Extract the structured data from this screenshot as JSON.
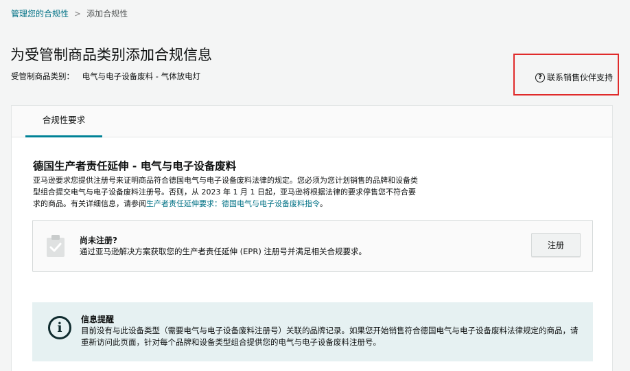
{
  "breadcrumb": {
    "parent": "管理您的合规性",
    "separator": ">",
    "current": "添加合规性"
  },
  "page": {
    "title": "为受管制商品类别添加合规信息",
    "category_label": "受管制商品类别：",
    "category_value": "电气与电子设备废料 - 气体放电灯"
  },
  "support": {
    "icon": "help-circle-icon",
    "icon_glyph": "?",
    "label": "联系销售伙伴支持",
    "highlight_color": "#e02a2a"
  },
  "tabs": [
    {
      "label": "合规性要求",
      "active": true
    }
  ],
  "section": {
    "title": "德国生产者责任延伸 - 电气与电子设备废料",
    "desc_line1": "亚马逊要求您提供注册号来证明商品符合德国电气与电子设备废料法律的规定。您必须为您计划销售的品牌和设备类",
    "desc_line2": "型组合提交电气与电子设备废料注册号。否则，从 2023 年 1 月 1 日起，亚马逊将根据法律的要求停售您不符合要",
    "desc_line3_prefix": "求的商品。有关详细信息，请参阅",
    "desc_link": "生产者责任延伸要求：德国电气与电子设备废料指令",
    "desc_line3_suffix": "。"
  },
  "registration": {
    "icon": "clipboard-check-icon",
    "title": "尚未注册?",
    "description": "通过亚马逊解决方案获取您的生产者责任延伸 (EPR) 注册号并满足相关合规要求。",
    "button_label": "注册"
  },
  "info": {
    "icon": "info-icon",
    "icon_glyph": "i",
    "title": "信息提醒",
    "text": "目前没有与此设备类型（需要电气与电子设备废料注册号）关联的品牌记录。如果您开始销售符合德国电气与电子设备废料法律规定的商品，请重新访问此页面，针对每个品牌和设备类型组合提供您的电气与电子设备废料注册号。"
  },
  "colors": {
    "link": "#007185",
    "tab_underline": "#008296",
    "info_background": "#e6f1f2"
  }
}
